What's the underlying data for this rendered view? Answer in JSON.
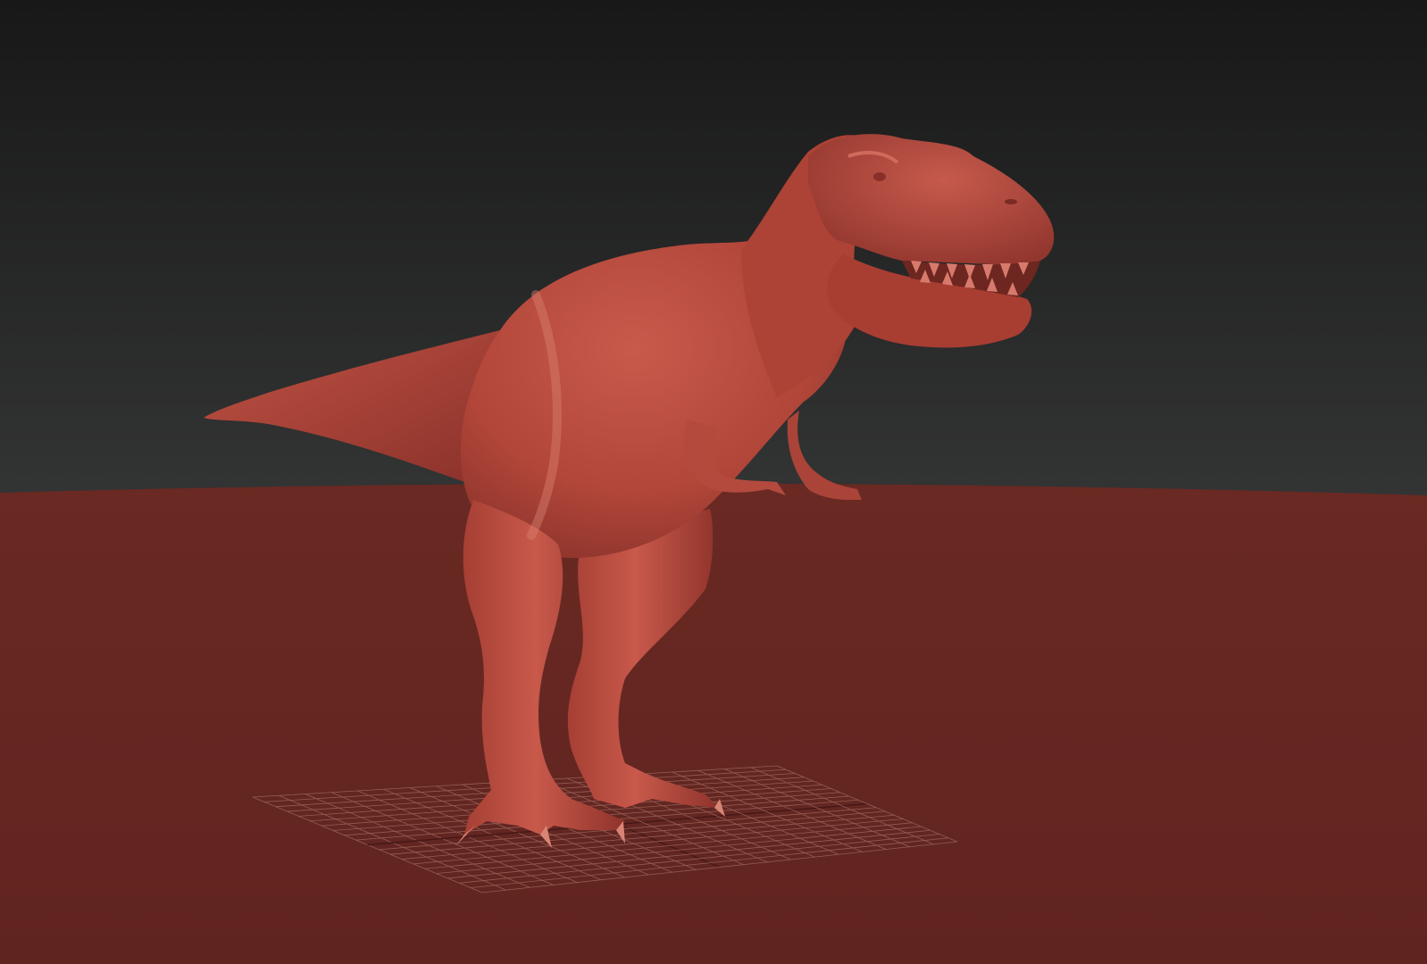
{
  "viewport": {
    "kind": "3d-sculpt-viewport",
    "background_top_color": "#1b1b1b",
    "background_mid_color": "#2f3030",
    "ground_color": "#652722",
    "grid_color": "#b8877a"
  },
  "model": {
    "subject": "tyrannosaurus-rex",
    "material_color": "#b84a3e",
    "highlight_color": "#d8776a",
    "shadow_color": "#7a2a24"
  }
}
